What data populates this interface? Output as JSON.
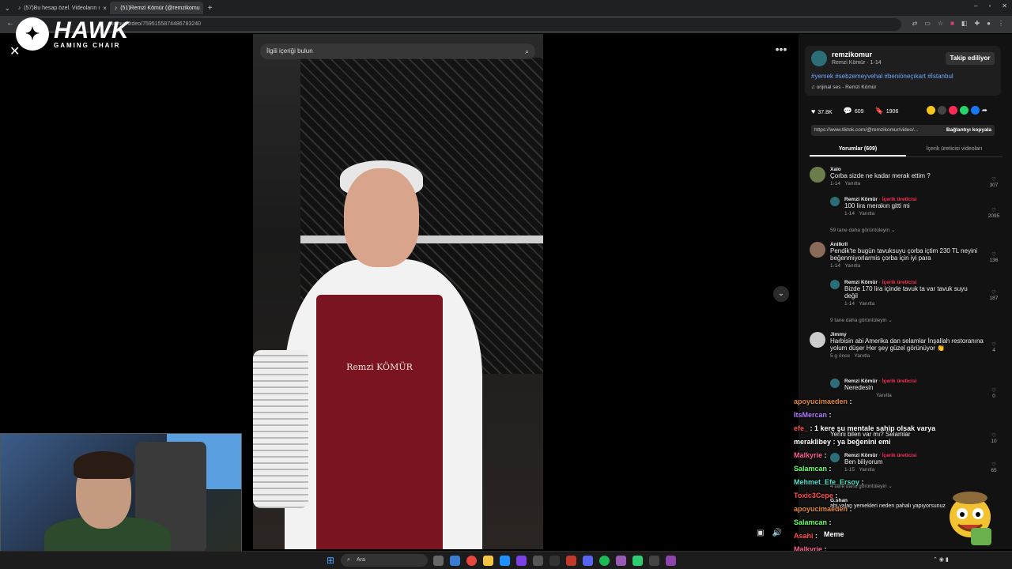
{
  "browser": {
    "tabs": [
      {
        "label": "(57)Bu hesap özel. Videoların ı"
      },
      {
        "label": "(51)Remzi Kömür (@remzikomu"
      }
    ],
    "url": "komur/video/7595155874486783240"
  },
  "overlay_logo": {
    "brand": "HAWK",
    "sub": "GAMING CHAIR"
  },
  "video": {
    "search_placeholder": "İlgili içeriği bulun",
    "apron_text": "Remzi KÖMÜR"
  },
  "post": {
    "username": "remzikomur",
    "subtitle": "Remzi Kömür · 1-14",
    "follow_label": "Takip ediliyor",
    "hashtags": "#yemek #sebzemeyvehal #beniöneçıkart #İstanbul",
    "sound": "orijinal ses - Remzi Kömür",
    "likes": "37.8K",
    "comments": "609",
    "saves": "1906",
    "link": "https://www.tiktok.com/@remzikomur/video/...",
    "copy_link": "Bağlantıyı kopyala",
    "tab_comments": "Yorumlar (609)",
    "tab_creator": "İçerik üreticisi videoları"
  },
  "comments": [
    {
      "user": "Xalo",
      "text": "Çorba sizde ne kadar merak ettim ?",
      "date": "1-14",
      "reply": "Yanıtla",
      "likes": "307"
    },
    {
      "user": "Remzi Kömür",
      "badge": "· İçerik üreticisi",
      "text": "100 lira merakın gitti mi",
      "date": "1-14",
      "reply": "Yanıtla",
      "likes": "2095"
    },
    {
      "more": "59 tane daha görüntüleyin ⌄"
    },
    {
      "user": "Anilkrll",
      "text": "Pendik'te bugün tavuksuyu çorba içtim 230 TL neyini beğenmiyorlarmis çorba için iyi para",
      "date": "1-14",
      "reply": "Yanıtla",
      "likes": "136"
    },
    {
      "user": "Remzi Kömür",
      "badge": "· İçerik üreticisi",
      "text": "Bizde 170 lira içinde tavuk ta var tavuk suyu değil",
      "date": "1-14",
      "reply": "Yanıtla",
      "likes": "187"
    },
    {
      "more": "9 tane daha görüntüleyin ⌄"
    },
    {
      "user": "Jimmy",
      "text": "Harbisin abi Amerika dan selamlar İnşallah restoranına yolum düşer Her şey güzel görünüyor 👏",
      "date": "5 g önce",
      "reply": "Yanıtla",
      "likes": "4"
    },
    {
      "user": "Remzi Kömür",
      "badge": "· İçerik üreticisi",
      "text": "Neredesin",
      "date": "",
      "reply": "Yanıtla",
      "likes": "0"
    },
    {
      "text": "Yerini bilen var mı? Selamlar",
      "likes": "10"
    },
    {
      "user": "Remzi Kömür",
      "badge": "· İçerik üreticisi",
      "text": "Ben biliyorum",
      "date": "1-15",
      "reply": "Yanıtla",
      "likes": "65"
    },
    {
      "more": "4 tane daha görüntüleyin ⌄"
    },
    {
      "user": "G.shan",
      "text": "abi yalan yemekleri neden pahalı yapıyorsunuz"
    }
  ],
  "chat": [
    {
      "user": "apoyucimaeden",
      "msg": "",
      "color": "#e08a3c"
    },
    {
      "user": "ItsMercan",
      "msg": "",
      "color": "#b57bff"
    },
    {
      "user": "efe_",
      "msg": "1 kere şu mentale sahip olsak varya",
      "color": "#ff4d4d"
    },
    {
      "user": "meraklibey",
      "msg": "ya beğenini emi",
      "color": "#ffffff"
    },
    {
      "user": "Malkyrie",
      "msg": "",
      "color": "#ff5b8c"
    },
    {
      "user": "Salamcan",
      "msg": "",
      "color": "#6aff6a"
    },
    {
      "user": "Mehmet_Efe_Ersoy",
      "msg": "",
      "color": "#4ae0c8"
    },
    {
      "user": "Toxic3Cepe",
      "msg": "",
      "color": "#ff4d4d"
    },
    {
      "user": "apoyucimaeden",
      "msg": "",
      "color": "#e08a3c"
    },
    {
      "user": "Salamcan",
      "msg": "",
      "color": "#6aff6a"
    },
    {
      "user": "Asahi",
      "msg": "",
      "color": "#ff4d4d"
    },
    {
      "user": "Malkyrie",
      "msg": "",
      "color": "#ff5b8c"
    },
    {
      "user": "apoyucimaeden",
      "msg": "",
      "color": "#e08a3c"
    }
  ],
  "meme_label": "Meme",
  "taskbar": {
    "search_label": "Ara"
  }
}
